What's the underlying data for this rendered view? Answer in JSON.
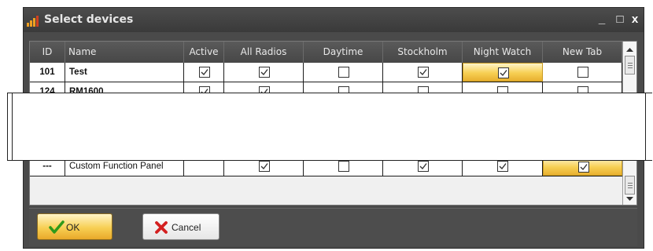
{
  "window": {
    "title": "Select devices",
    "minimize_label": "_",
    "maximize_label": "□",
    "close_label": "x",
    "app_icon": "signal-bars-icon"
  },
  "grid": {
    "columns": [
      "ID",
      "Name",
      "Active",
      "All Radios",
      "Daytime",
      "Stockholm",
      "Night Watch",
      "New Tab"
    ],
    "rows": [
      {
        "id": "101",
        "name": "Test",
        "name_bold": true,
        "checks": [
          true,
          true,
          false,
          true,
          true,
          false
        ],
        "highlight_col": 4
      },
      {
        "id": "124",
        "name": "RM1600",
        "name_bold": true,
        "checks": [
          true,
          true,
          false,
          false,
          false,
          false
        ],
        "partial": true
      },
      {
        "id": "---",
        "name": "Custom Function Panel",
        "name_bold": false,
        "checks": [
          null,
          true,
          false,
          true,
          true,
          true
        ],
        "highlight_col": 5
      }
    ]
  },
  "footer": {
    "ok_label": "OK",
    "cancel_label": "Cancel",
    "ok_icon": "checkmark-icon",
    "cancel_icon": "x-icon"
  },
  "colors": {
    "highlight": "#f7cf53",
    "window_bg": "#4a4a4a",
    "header_bg": "#474747"
  }
}
